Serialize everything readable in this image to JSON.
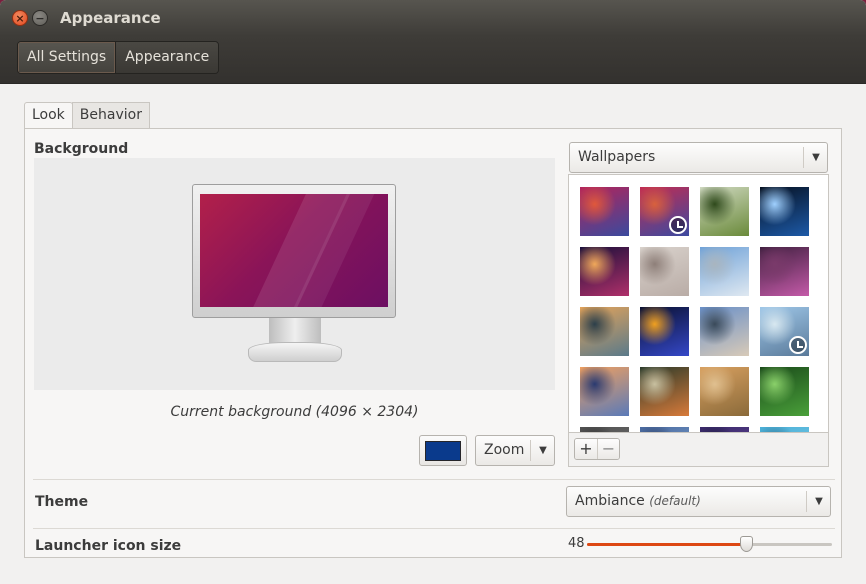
{
  "window": {
    "title": "Appearance",
    "close_glyph": "×",
    "minimize_glyph": "−"
  },
  "toolbar": {
    "breadcrumbs": [
      {
        "label": "All Settings"
      },
      {
        "label": "Appearance"
      }
    ]
  },
  "tabs": [
    {
      "label": "Look",
      "active": true
    },
    {
      "label": "Behavior",
      "active": false
    }
  ],
  "background": {
    "section_label": "Background",
    "caption": "Current background (4096 × 2304)",
    "color_swatch": "#0a3a8c",
    "mode": "Zoom",
    "source": "Wallpapers",
    "add_glyph": "+",
    "remove_glyph": "−",
    "wallpapers": [
      {
        "name": "wallpaper-1",
        "colors": [
          "#b3245a",
          "#3a4a9e",
          "#e0583b"
        ],
        "clock": false
      },
      {
        "name": "wallpaper-2",
        "colors": [
          "#c12c52",
          "#3c4aa0",
          "#d8613d"
        ],
        "clock": true
      },
      {
        "name": "wallpaper-3",
        "colors": [
          "#cfd8c0",
          "#6a8a3a",
          "#2f4a1c"
        ],
        "clock": false
      },
      {
        "name": "wallpaper-4",
        "colors": [
          "#061020",
          "#1d5aa8",
          "#9fd0ff"
        ],
        "clock": false
      },
      {
        "name": "wallpaper-5",
        "colors": [
          "#1a0f3a",
          "#b0306a",
          "#f0a85a"
        ],
        "clock": false
      },
      {
        "name": "wallpaper-6",
        "colors": [
          "#d9d2cc",
          "#b9aca6",
          "#8e7f79"
        ],
        "clock": false
      },
      {
        "name": "wallpaper-7",
        "colors": [
          "#6fa2d8",
          "#dfe8f1",
          "#a9b5bf"
        ],
        "clock": false
      },
      {
        "name": "wallpaper-8",
        "colors": [
          "#402040",
          "#c45aa8",
          "#7a3a6a"
        ],
        "clock": false
      },
      {
        "name": "wallpaper-9",
        "colors": [
          "#e3a35a",
          "#5a7a8a",
          "#2c3f4a"
        ],
        "clock": false
      },
      {
        "name": "wallpaper-10",
        "colors": [
          "#0a1030",
          "#3548c8",
          "#f0a020"
        ],
        "clock": false
      },
      {
        "name": "wallpaper-11",
        "colors": [
          "#6a90c8",
          "#d8cab8",
          "#3a4a5a"
        ],
        "clock": false
      },
      {
        "name": "wallpaper-12",
        "colors": [
          "#9fc7e8",
          "#5a7a9a",
          "#d8e8f0"
        ],
        "clock": true
      },
      {
        "name": "wallpaper-13",
        "colors": [
          "#f0a060",
          "#5a7ab8",
          "#2a3a70"
        ],
        "clock": false
      },
      {
        "name": "wallpaper-14",
        "colors": [
          "#2a3a2a",
          "#d87a3a",
          "#c8c0a0"
        ],
        "clock": false
      },
      {
        "name": "wallpaper-15",
        "colors": [
          "#d8a060",
          "#8a6a3a",
          "#e0c090"
        ],
        "clock": false
      },
      {
        "name": "wallpaper-16",
        "colors": [
          "#1a4a1a",
          "#4aa03a",
          "#8ad06a"
        ],
        "clock": false
      },
      {
        "name": "wallpaper-17",
        "colors": [
          "#505050",
          "#7a7a7a",
          "#303030"
        ],
        "clock": false
      },
      {
        "name": "wallpaper-18",
        "colors": [
          "#4a6aa0",
          "#8ab0d8",
          "#2a3a60"
        ],
        "clock": false
      },
      {
        "name": "wallpaper-19",
        "colors": [
          "#3a2a6a",
          "#6a4aa0",
          "#1a1a3a"
        ],
        "clock": false
      },
      {
        "name": "wallpaper-20",
        "colors": [
          "#4ab0d8",
          "#8ad0e8",
          "#2a6a8a"
        ],
        "clock": false
      }
    ]
  },
  "theme": {
    "label": "Theme",
    "value": "Ambiance",
    "note": "(default)"
  },
  "launcher": {
    "label": "Launcher icon size",
    "value": "48",
    "fraction": 0.65
  }
}
